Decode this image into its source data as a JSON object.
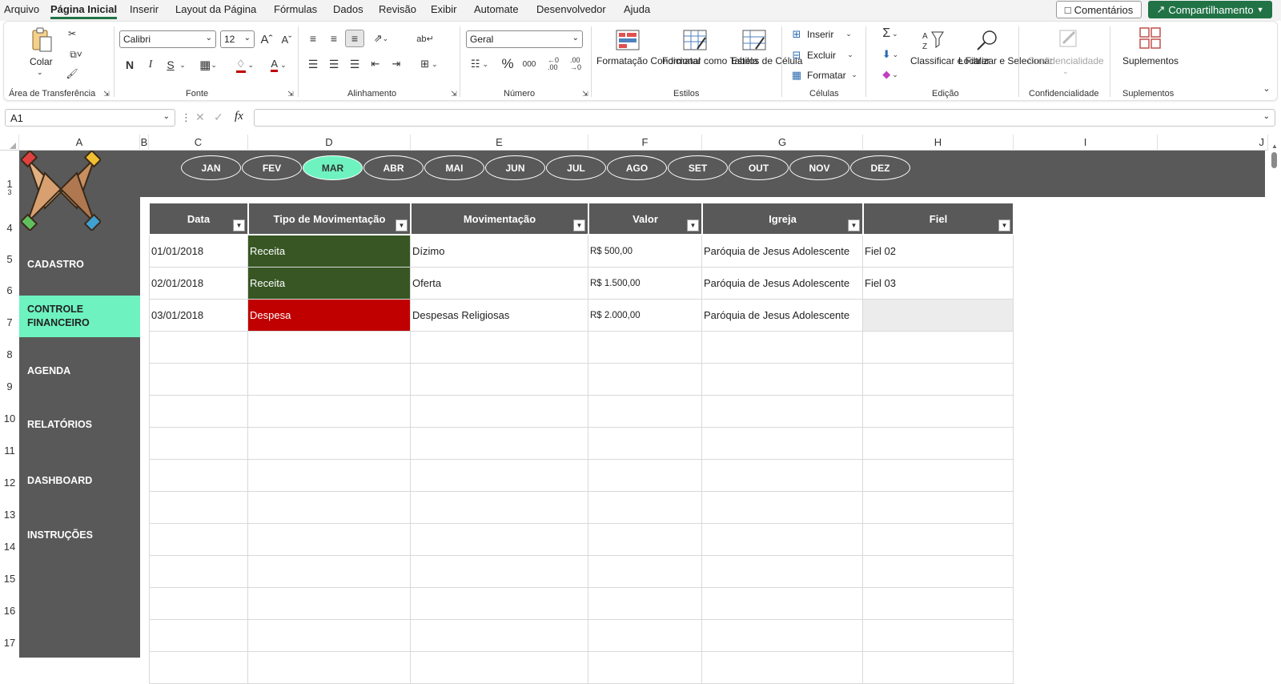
{
  "menu": {
    "items": [
      "Arquivo",
      "Página Inicial",
      "Inserir",
      "Layout da Página",
      "Fórmulas",
      "Dados",
      "Revisão",
      "Exibir",
      "Automate",
      "Desenvolvedor",
      "Ajuda"
    ],
    "comments_label": "Comentários",
    "share_label": "Compartilhamento"
  },
  "ribbon": {
    "clipboard": {
      "paste_label": "Colar",
      "group": "Área de Transferência"
    },
    "font": {
      "name": "Calibri",
      "size": "12",
      "group": "Fonte",
      "bold": "N",
      "italic": "I",
      "underline": "S"
    },
    "alignment": {
      "group": "Alinhamento"
    },
    "number": {
      "format": "Geral",
      "group": "Número"
    },
    "styles": {
      "cond_format": "Formatação Condicional",
      "format_table": "Formatar como Tabela",
      "cell_styles": "Estilos de Célula",
      "group": "Estilos"
    },
    "cells": {
      "insert": "Inserir",
      "delete": "Excluir",
      "format": "Formatar",
      "group": "Células"
    },
    "editing": {
      "sort_filter": "Classificar e Filtrar",
      "find_select": "Localizar e Selecionar",
      "group": "Edição"
    },
    "sensitivity": {
      "label": "Confidencialidade",
      "group": "Confidencialidade"
    },
    "addins": {
      "label": "Suplementos",
      "group": "Suplementos"
    }
  },
  "formula_bar": {
    "name_box": "A1",
    "formula": ""
  },
  "columns": [
    "A",
    "B",
    "C",
    "D",
    "E",
    "F",
    "G",
    "H",
    "I",
    "J"
  ],
  "rows": [
    "1",
    "3",
    "4",
    "5",
    "6",
    "7",
    "8",
    "9",
    "10",
    "11",
    "12",
    "13",
    "14",
    "15",
    "16",
    "17"
  ],
  "months": [
    "JAN",
    "FEV",
    "MAR",
    "ABR",
    "MAI",
    "JUN",
    "JUL",
    "AGO",
    "SET",
    "OUT",
    "NOV",
    "DEZ"
  ],
  "active_month": "MAR",
  "nav": [
    "CADASTRO",
    "CONTROLE FINANCEIRO",
    "AGENDA",
    "RELATÓRIOS",
    "DASHBOARD",
    "INSTRUÇÕES"
  ],
  "active_nav": "CONTROLE FINANCEIRO",
  "table": {
    "headers": [
      "Data",
      "Tipo de Movimentação",
      "Movimentação",
      "Valor",
      "Igreja",
      "Fiel"
    ],
    "rows": [
      [
        "01/01/2018",
        "Receita",
        "Dízimo",
        "R$ 500,00",
        "Paróquia de Jesus Adolescente",
        "Fiel 02"
      ],
      [
        "02/01/2018",
        "Receita",
        "Oferta",
        "R$ 1.500,00",
        "Paróquia de Jesus Adolescente",
        "Fiel 03"
      ],
      [
        "03/01/2018",
        "Despesa",
        "Despesas Religiosas",
        "R$ 2.000,00",
        "Paróquia de Jesus Adolescente",
        ""
      ]
    ]
  },
  "colors": {
    "receita": "#375623",
    "despesa": "#c00000",
    "accent": "#6ef3c0",
    "dark": "#595959",
    "excel_green": "#217346"
  }
}
